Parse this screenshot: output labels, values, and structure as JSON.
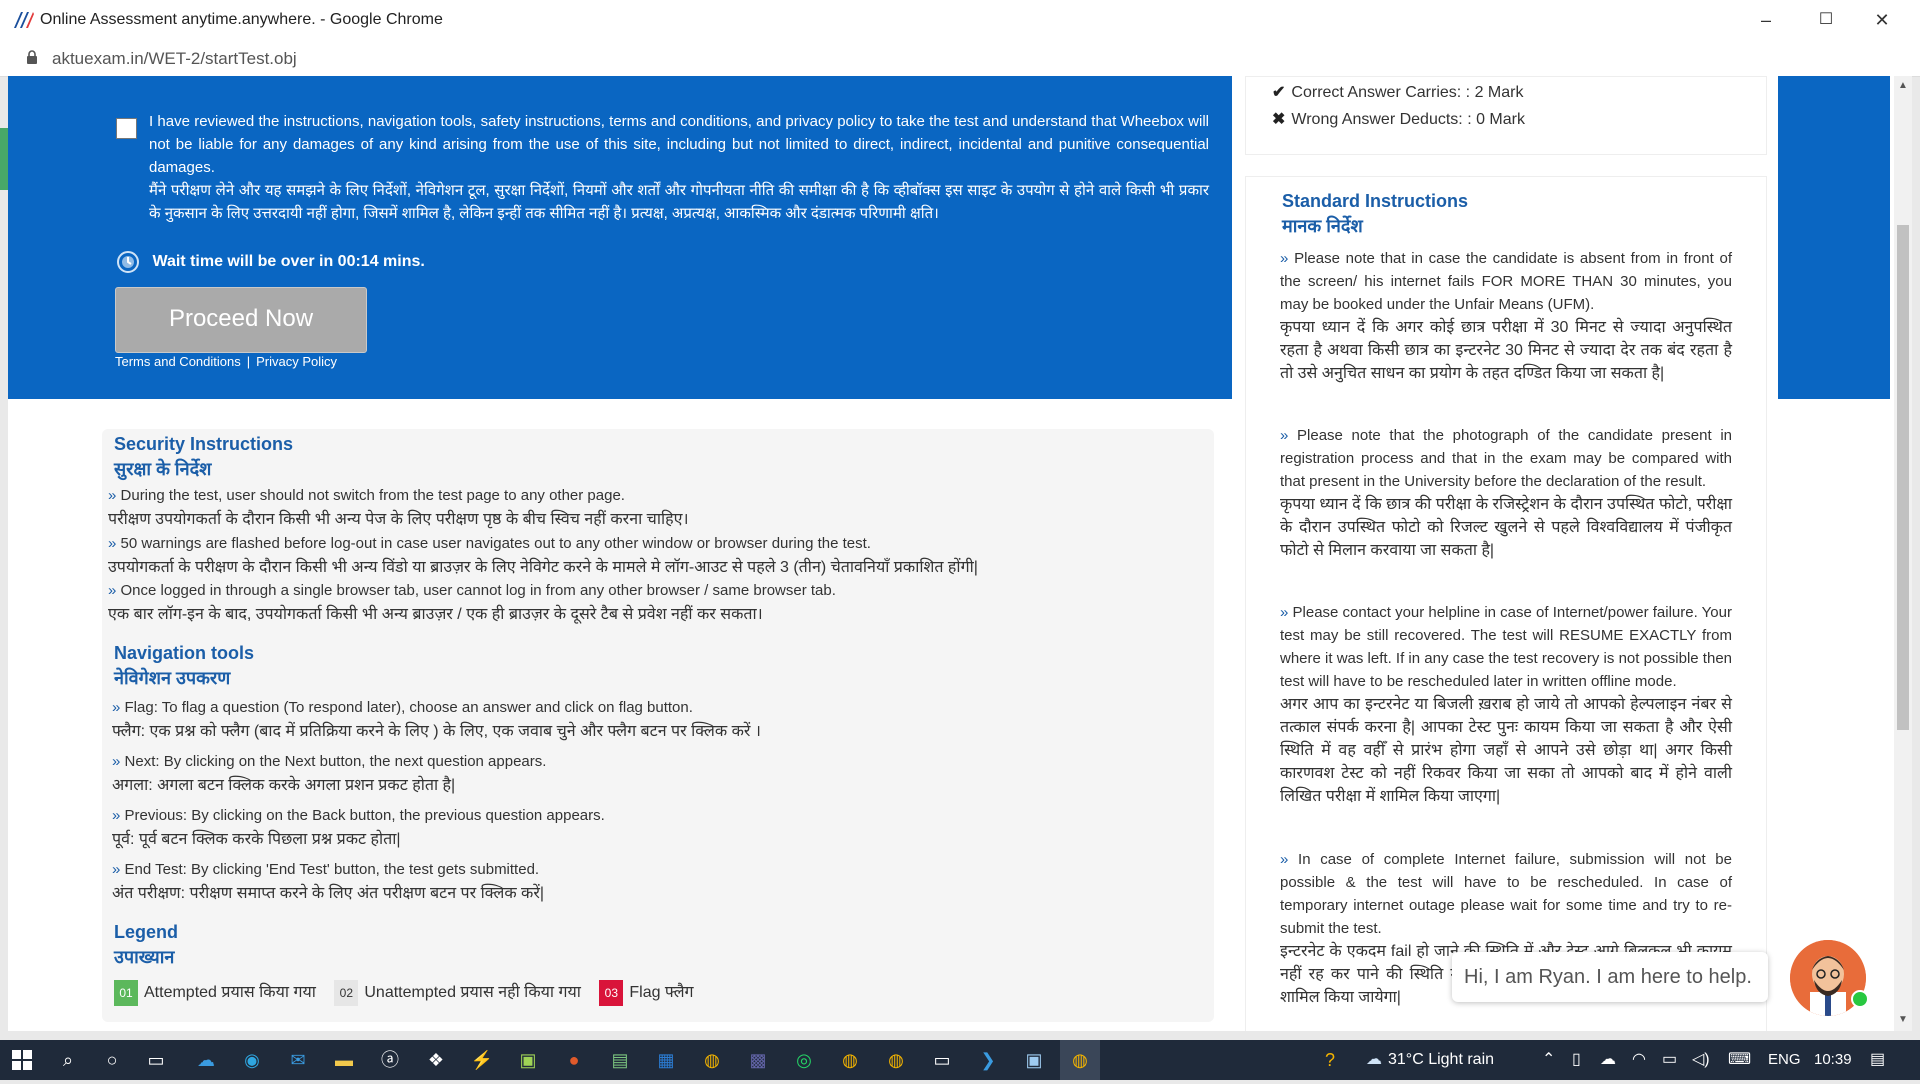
{
  "browser": {
    "window_title": "Online Assessment anytime.anywhere. - Google Chrome",
    "url": "aktuexam.in/WET-2/startTest.obj",
    "minimize": "–",
    "maximize": "☐",
    "close": "✕"
  },
  "consent": {
    "en": "I have reviewed the instructions, navigation tools, safety instructions, terms and conditions, and privacy policy to take the test and understand that Wheebox will not be liable for any damages of any kind arising from the use of this site, including but not limited to direct, indirect, incidental and punitive consequential damages.",
    "hi": "मैंने परीक्षण लेने और यह समझने के लिए निर्देशों, नेविगेशन टूल, सुरक्षा निर्देशों, नियमों और शर्तों और गोपनीयता नीति की समीक्षा की है कि व्हीबॉक्स इस साइट के उपयोग से होने वाले किसी भी प्रकार के नुकसान के लिए उत्तरदायी नहीं होगा, जिसमें शामिल है, लेकिन इन्हीं तक सीमित नहीं है। प्रत्यक्ष, अप्रत्यक्ष, आकस्मिक और दंडात्मक परिणामी क्षति।"
  },
  "wait_text": "Wait time will be over in 00:14 mins.",
  "proceed_label": "Proceed Now",
  "links": {
    "terms": "Terms and Conditions",
    "sep": "|",
    "privacy": "Privacy Policy"
  },
  "marks": {
    "correct": "Correct Answer Carries: : 2 Mark",
    "wrong": "Wrong Answer Deducts: : 0 Mark"
  },
  "security": {
    "title_en": "Security Instructions",
    "title_hi": "सुरक्षा के निर्देश",
    "items": [
      {
        "en": "During the test, user should not switch from the test page to any other page.",
        "hi": "परीक्षण उपयोगकर्ता के दौरान किसी भी अन्य पेज के लिए परीक्षण पृष्ठ के बीच स्विच नहीं करना चाहिए।"
      },
      {
        "en": "50 warnings are flashed before log-out in case user navigates out to any other window or browser during the test.",
        "hi": "उपयोगकर्ता के परीक्षण के दौरान किसी भी अन्य विंडो या ब्राउज़र के लिए नेविगेट करने के मामले मे लॉग-आउट से पहले 3 (तीन) चेतावनियाँ प्रकाशित होंगी|"
      },
      {
        "en": "Once logged in through a single browser tab, user cannot log in from any other browser / same browser tab.",
        "hi": "एक बार लॉग-इन के बाद, उपयोगकर्ता किसी भी अन्य ब्राउज़र / एक ही ब्राउज़र के दूसरे टैब से प्रवेश नहीं कर सकता।"
      }
    ]
  },
  "navigation": {
    "title_en": "Navigation tools",
    "title_hi": "नेविगेशन उपकरण",
    "items": [
      {
        "en": "Flag: To flag a question (To respond later), choose an answer and click on flag button.",
        "hi": "फ्लैग: एक प्रश्न को फ्लैग (बाद में प्रतिक्रिया करने के लिए ) के लिए, एक जवाब चुने और फ्लैग बटन पर क्लिक करें ।"
      },
      {
        "en": "Next: By clicking on the Next button, the next question appears.",
        "hi": "अगला: अगला बटन क्लिक करके अगला प्रशन प्रकट होता है|"
      },
      {
        "en": "Previous: By clicking on the Back button, the previous question appears.",
        "hi": "पूर्व: पूर्व बटन क्लिक करके पिछला प्रश्न प्रकट होता|"
      },
      {
        "en": "End Test: By clicking 'End Test' button, the test gets submitted.",
        "hi": "अंत परीक्षण: परीक्षण समाप्त करने के लिए अंत परीक्षण बटन पर क्लिक करें|"
      }
    ]
  },
  "legend": {
    "title_en": "Legend",
    "title_hi": "उपाख्यान",
    "items": [
      {
        "num": "01",
        "label": "Attempted प्रयास किया गया",
        "color": "#5cb85c"
      },
      {
        "num": "02",
        "label": "Unattempted प्रयास नही किया गया",
        "color": "#e6e6e6"
      },
      {
        "num": "03",
        "label": "Flag फ्लैग",
        "color": "#d9143a"
      }
    ]
  },
  "standard": {
    "title_en": "Standard Instructions",
    "title_hi": "मानक निर्देश",
    "items": [
      {
        "en": "Please note that in case the candidate is absent from in front of the screen/ his internet fails FOR MORE THAN 30 minutes, you may be booked under the Unfair Means (UFM).",
        "hi": "कृपया ध्यान दें कि अगर कोई छात्र परीक्षा में 30 मिनट से ज्यादा अनुपस्थित रहता है अथवा किसी छात्र का इन्टरनेट 30 मिनट से ज्यादा देर तक बंद रहता है तो उसे अनुचित साधन का प्रयोग के तहत दण्डित किया जा सकता है|"
      },
      {
        "en": "Please note that the photograph of the candidate present in registration process and that in the exam may be compared with that present in the University before the declaration of the result.",
        "hi": "कृपया ध्यान दें कि छात्र की परीक्षा के रजिस्ट्रेशन के दौरान उपस्थित फोटो, परीक्षा के दौरान उपस्थित फोटो को रिजल्ट खुलने से पहले विश्वविद्यालय में पंजीकृत फोटो से मिलान करवाया जा सकता है|"
      },
      {
        "en": "Please contact your helpline in case of Internet/power failure. Your test may be still recovered. The test will RESUME EXACTLY from where it was left. If in any case the test recovery is not possible then test will have to be rescheduled later in written offline mode.",
        "hi": "अगर आप का इन्टरनेट या बिजली ख़राब हो जाये तो आपको हेल्पलाइन नंबर से तत्काल संपर्क करना है| आपका टेस्ट पुनः कायम किया जा सकता है और ऐसी स्थिति में वह वहीँ से प्रारंभ होगा जहाँ से आपने उसे छोड़ा था| अगर किसी कारणवश टेस्ट को नहीं रिकवर किया जा सका तो आपको बाद में होने वाली लिखित परीक्षा में शामिल किया जाएगा|"
      },
      {
        "en": "In case of complete Internet failure, submission will not be possible & the test will have to be rescheduled. In case of temporary internet outage please wait for some time and try to re-submit the test.",
        "hi": "इन्टरनेट के एकदम fail हो जाने की स्थिति में और टेस्ट आगे बिलकुल भी कायम नहीं रह कर पाने की स्थिति में छात्र को बाद में होने वाली लिखित परीक्षा में शामिल किया जायेगा|"
      }
    ]
  },
  "chat": {
    "text": "Hi, I am Ryan. I am here to help."
  },
  "taskbar": {
    "weather": "31°C  Light rain",
    "lang": "ENG",
    "time": "10:39"
  },
  "colors": {
    "primary_blue": "#0a66c2",
    "heading_blue": "#1b5ea8",
    "proceed_gray": "#aaaaaa"
  }
}
